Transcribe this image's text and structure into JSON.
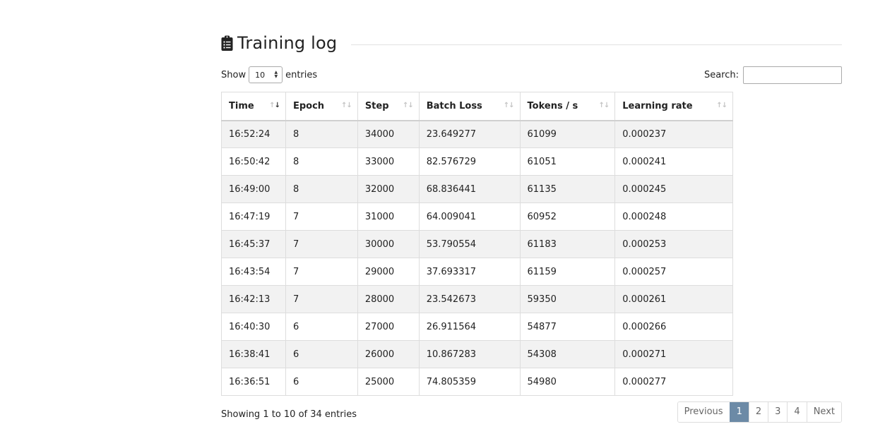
{
  "section": {
    "title": "Training log"
  },
  "length_control": {
    "show_label": "Show",
    "value": "10",
    "entries_label": "entries"
  },
  "search": {
    "label": "Search:",
    "value": ""
  },
  "table": {
    "columns": [
      "Time",
      "Epoch",
      "Step",
      "Batch Loss",
      "Tokens / s",
      "Learning rate"
    ],
    "sorted_column": "Time",
    "sort_direction": "descending",
    "rows": [
      [
        "16:52:24",
        "8",
        "34000",
        "23.649277",
        "61099",
        "0.000237"
      ],
      [
        "16:50:42",
        "8",
        "33000",
        "82.576729",
        "61051",
        "0.000241"
      ],
      [
        "16:49:00",
        "8",
        "32000",
        "68.836441",
        "61135",
        "0.000245"
      ],
      [
        "16:47:19",
        "7",
        "31000",
        "64.009041",
        "60952",
        "0.000248"
      ],
      [
        "16:45:37",
        "7",
        "30000",
        "53.790554",
        "61183",
        "0.000253"
      ],
      [
        "16:43:54",
        "7",
        "29000",
        "37.693317",
        "61159",
        "0.000257"
      ],
      [
        "16:42:13",
        "7",
        "28000",
        "23.542673",
        "59350",
        "0.000261"
      ],
      [
        "16:40:30",
        "6",
        "27000",
        "26.911564",
        "54877",
        "0.000266"
      ],
      [
        "16:38:41",
        "6",
        "26000",
        "10.867283",
        "54308",
        "0.000271"
      ],
      [
        "16:36:51",
        "6",
        "25000",
        "74.805359",
        "54980",
        "0.000277"
      ]
    ]
  },
  "footer": {
    "info": "Showing 1 to 10 of 34 entries"
  },
  "pagination": {
    "previous": "Previous",
    "pages": [
      "1",
      "2",
      "3",
      "4"
    ],
    "active_page": "1",
    "next": "Next"
  },
  "colors": {
    "accent": "#6c8aa6",
    "stripe": "#f2f2f2",
    "border": "#dddddd"
  }
}
